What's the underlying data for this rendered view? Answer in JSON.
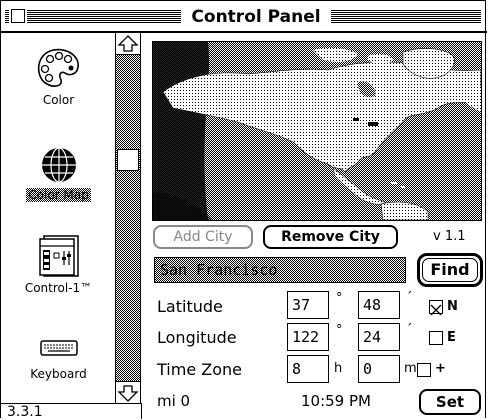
{
  "window": {
    "title": "Control Panel"
  },
  "sidebar": {
    "items": [
      {
        "label": "Color",
        "icon": "palette-icon"
      },
      {
        "label": "Color Map",
        "icon": "globe-icon",
        "selected": true
      },
      {
        "label": "Control-1™",
        "icon": "control-panel-icon"
      },
      {
        "label": "Keyboard",
        "icon": "keyboard-icon"
      }
    ],
    "status": "3.3.1"
  },
  "map": {
    "buttons": {
      "add_city": "Add City",
      "remove_city": "Remove City"
    },
    "version": "v 1.1",
    "city": "San Francisco",
    "find_label": "Find",
    "latitude": {
      "label": "Latitude",
      "deg": "37",
      "min": "48",
      "deg_unit": "°",
      "min_unit": "´",
      "dir": "N",
      "checked": true
    },
    "longitude": {
      "label": "Longitude",
      "deg": "122",
      "min": "24",
      "deg_unit": "°",
      "min_unit": "´",
      "dir": "E",
      "checked": false
    },
    "timezone": {
      "label": "Time Zone",
      "hours": "8",
      "minutes": "0",
      "h_unit": "h",
      "m_unit": "m",
      "sign": "+",
      "checked": false
    },
    "distance": "mi  0",
    "time": "10:59 PM",
    "set_label": "Set"
  }
}
